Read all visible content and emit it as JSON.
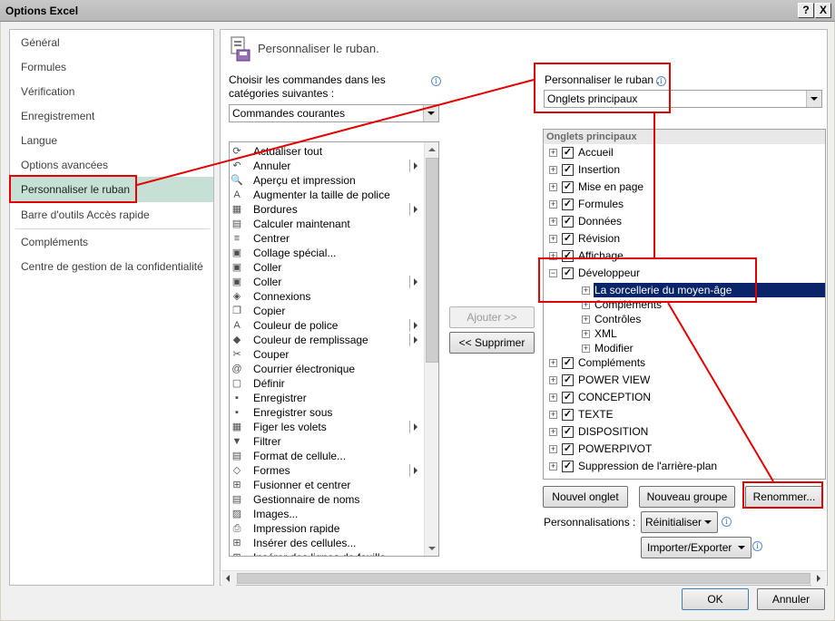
{
  "window": {
    "title": "Options Excel",
    "help_label": "?",
    "close_label": "X"
  },
  "sidebar": {
    "items": [
      {
        "label": "Général"
      },
      {
        "label": "Formules"
      },
      {
        "label": "Vérification"
      },
      {
        "label": "Enregistrement"
      },
      {
        "label": "Langue"
      },
      {
        "label": "Options avancées"
      },
      {
        "label": "Personnaliser le ruban"
      },
      {
        "label": "Barre d'outils Accès rapide"
      },
      {
        "label": "Compléments"
      },
      {
        "label": "Centre de gestion de la confidentialité"
      }
    ],
    "selected": "Personnaliser le ruban"
  },
  "main": {
    "header": "Personnaliser le ruban.",
    "choose_label": "Choisir les commandes dans les catégories suivantes :",
    "choose_value": "Commandes courantes",
    "customize_label": "Personnaliser le ruban :",
    "customize_value": "Onglets principaux",
    "commands": [
      {
        "label": "Actualiser tout",
        "icon": "refresh-icon",
        "glyph": "⟳",
        "submenu": false
      },
      {
        "label": "Annuler",
        "icon": "undo-icon",
        "glyph": "↶",
        "submenu": true
      },
      {
        "label": "Aperçu et impression",
        "icon": "print-preview-icon",
        "glyph": "🔍",
        "submenu": false
      },
      {
        "label": "Augmenter la taille de police",
        "icon": "font-grow-icon",
        "glyph": "A",
        "submenu": false
      },
      {
        "label": "Bordures",
        "icon": "borders-icon",
        "glyph": "▦",
        "submenu": true
      },
      {
        "label": "Calculer maintenant",
        "icon": "calculator-icon",
        "glyph": "▤",
        "submenu": false
      },
      {
        "label": "Centrer",
        "icon": "align-center-icon",
        "glyph": "≡",
        "submenu": false
      },
      {
        "label": "Collage spécial...",
        "icon": "paste-special-icon",
        "glyph": "▣",
        "submenu": false
      },
      {
        "label": "Coller",
        "icon": "paste-icon",
        "glyph": "▣",
        "submenu": false
      },
      {
        "label": "Coller",
        "icon": "paste-icon",
        "glyph": "▣",
        "submenu": true
      },
      {
        "label": "Connexions",
        "icon": "connections-icon",
        "glyph": "◈",
        "submenu": false
      },
      {
        "label": "Copier",
        "icon": "copy-icon",
        "glyph": "❐",
        "submenu": false
      },
      {
        "label": "Couleur de police",
        "icon": "font-color-icon",
        "glyph": "A",
        "submenu": true
      },
      {
        "label": "Couleur de remplissage",
        "icon": "fill-color-icon",
        "glyph": "◆",
        "submenu": true
      },
      {
        "label": "Couper",
        "icon": "cut-icon",
        "glyph": "✂",
        "submenu": false
      },
      {
        "label": "Courrier électronique",
        "icon": "email-icon",
        "glyph": "@",
        "submenu": false
      },
      {
        "label": "Définir",
        "icon": "define-icon",
        "glyph": "▢",
        "submenu": false
      },
      {
        "label": "Enregistrer",
        "icon": "save-icon",
        "glyph": "▪",
        "submenu": false
      },
      {
        "label": "Enregistrer sous",
        "icon": "save-as-icon",
        "glyph": "▪",
        "submenu": false
      },
      {
        "label": "Figer les volets",
        "icon": "freeze-panes-icon",
        "glyph": "▦",
        "submenu": true
      },
      {
        "label": "Filtrer",
        "icon": "filter-icon",
        "glyph": "▼",
        "submenu": false
      },
      {
        "label": "Format de cellule...",
        "icon": "format-cells-icon",
        "glyph": "▤",
        "submenu": false
      },
      {
        "label": "Formes",
        "icon": "shapes-icon",
        "glyph": "◇",
        "submenu": true
      },
      {
        "label": "Fusionner et centrer",
        "icon": "merge-center-icon",
        "glyph": "⊞",
        "submenu": false
      },
      {
        "label": "Gestionnaire de noms",
        "icon": "name-manager-icon",
        "glyph": "▤",
        "submenu": false
      },
      {
        "label": "Images...",
        "icon": "images-icon",
        "glyph": "▨",
        "submenu": false
      },
      {
        "label": "Impression rapide",
        "icon": "quick-print-icon",
        "glyph": "⎙",
        "submenu": false
      },
      {
        "label": "Insérer des cellules...",
        "icon": "insert-cells-icon",
        "glyph": "⊞",
        "submenu": false
      },
      {
        "label": "Insérer des lignes de feuille",
        "icon": "insert-rows-icon",
        "glyph": "⊞",
        "submenu": false
      }
    ],
    "add_button": "Ajouter >>",
    "remove_button": "<< Supprimer",
    "tree_header": "Onglets principaux",
    "tree": [
      {
        "label": "Accueil",
        "level": 0,
        "expander": "+",
        "checked": true
      },
      {
        "label": "Insertion",
        "level": 0,
        "expander": "+",
        "checked": true
      },
      {
        "label": "Mise en page",
        "level": 0,
        "expander": "+",
        "checked": true
      },
      {
        "label": "Formules",
        "level": 0,
        "expander": "+",
        "checked": true
      },
      {
        "label": "Données",
        "level": 0,
        "expander": "+",
        "checked": true
      },
      {
        "label": "Révision",
        "level": 0,
        "expander": "+",
        "checked": true
      },
      {
        "label": "Affichage",
        "level": 0,
        "expander": "+",
        "checked": true
      },
      {
        "label": "Développeur",
        "level": 0,
        "expander": "−",
        "checked": true
      },
      {
        "label": "La sorcellerie du moyen-âge",
        "level": 1,
        "expander": "+",
        "checked": null,
        "selected": true
      },
      {
        "label": "Compléments",
        "level": 1,
        "expander": "+",
        "checked": null
      },
      {
        "label": "Contrôles",
        "level": 1,
        "expander": "+",
        "checked": null
      },
      {
        "label": "XML",
        "level": 1,
        "expander": "+",
        "checked": null
      },
      {
        "label": "Modifier",
        "level": 1,
        "expander": "+",
        "checked": null
      },
      {
        "label": "Compléments",
        "level": 0,
        "expander": "+",
        "checked": true
      },
      {
        "label": "POWER VIEW",
        "level": 0,
        "expander": "+",
        "checked": true
      },
      {
        "label": "CONCEPTION",
        "level": 0,
        "expander": "+",
        "checked": true
      },
      {
        "label": "TEXTE",
        "level": 0,
        "expander": "+",
        "checked": true
      },
      {
        "label": "DISPOSITION",
        "level": 0,
        "expander": "+",
        "checked": true
      },
      {
        "label": "POWERPIVOT",
        "level": 0,
        "expander": "+",
        "checked": true
      },
      {
        "label": "Suppression de l'arrière-plan",
        "level": 0,
        "expander": "+",
        "checked": true
      }
    ],
    "new_tab_button": "Nouvel onglet",
    "new_group_button": "Nouveau groupe",
    "rename_button": "Renommer...",
    "customizations_label": "Personnalisations :",
    "reset_button": "Réinitialiser",
    "import_export_button": "Importer/Exporter"
  },
  "footer": {
    "ok_button": "OK",
    "cancel_button": "Annuler"
  },
  "colors": {
    "annotation_red": "#e20000",
    "selected_nav": "#c7e0d6",
    "selected_tree": "#0a246a"
  }
}
